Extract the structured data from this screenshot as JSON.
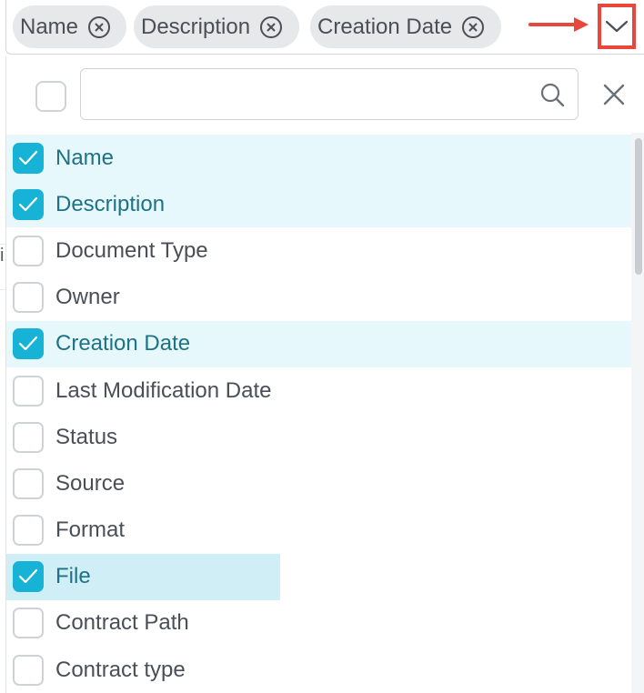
{
  "chips": [
    {
      "label": "Name"
    },
    {
      "label": "Description"
    },
    {
      "label": "Creation Date"
    }
  ],
  "icons": {
    "chip_remove": "circle-x-icon",
    "toggle": "chevron-down-icon",
    "search": "search-icon",
    "close": "close-icon",
    "check": "check-icon",
    "annotation": "red-arrow-icon"
  },
  "search": {
    "value": "",
    "placeholder": ""
  },
  "options": [
    {
      "label": "Name",
      "checked": true
    },
    {
      "label": "Description",
      "checked": true
    },
    {
      "label": "Document Type",
      "checked": false
    },
    {
      "label": "Owner",
      "checked": false
    },
    {
      "label": "Creation Date",
      "checked": true
    },
    {
      "label": "Last Modification Date",
      "checked": false
    },
    {
      "label": "Status",
      "checked": false
    },
    {
      "label": "Source",
      "checked": false
    },
    {
      "label": "Format",
      "checked": false
    },
    {
      "label": "File",
      "checked": true,
      "highlighted": true
    },
    {
      "label": "Contract Path",
      "checked": false
    },
    {
      "label": "Contract type",
      "checked": false
    }
  ],
  "colors": {
    "accent": "#16b3d6",
    "annotation": "#e8473b",
    "selected_text": "#1e7287"
  }
}
